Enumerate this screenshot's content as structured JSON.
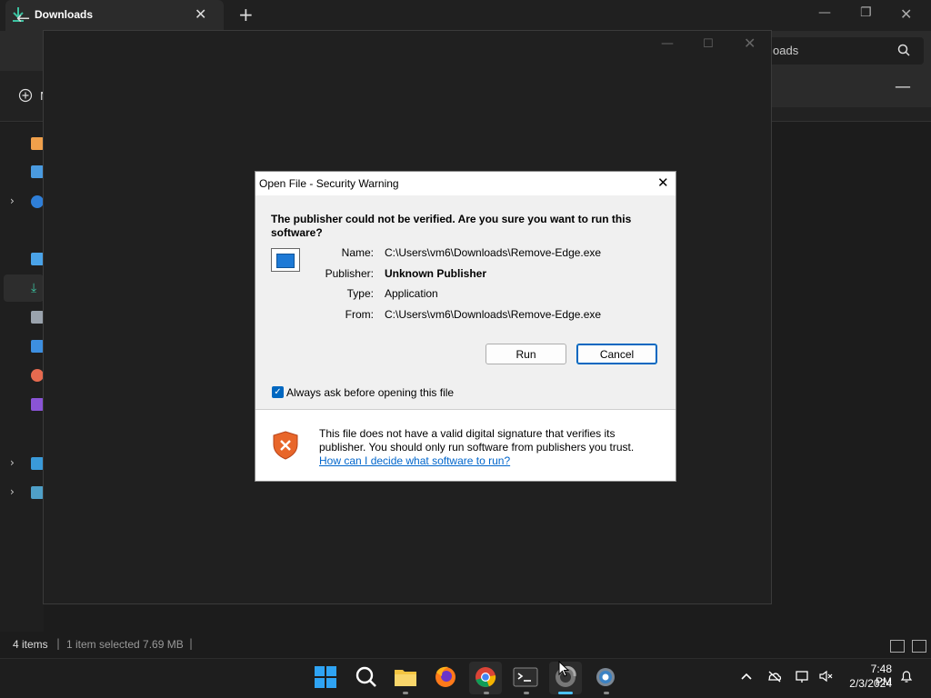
{
  "explorer": {
    "tab_title": "Downloads",
    "search_text": "oads",
    "new_label": "N",
    "status": {
      "items_count": "4 items",
      "separator": "|",
      "selected_info": "1 item selected  7.69 MB",
      "separator2": "|"
    }
  },
  "dialog": {
    "title": "Open File - Security Warning",
    "question": "The publisher could not be verified.  Are you sure you want to run this software?",
    "fields": {
      "name_label": "Name:",
      "name_value": "C:\\Users\\vm6\\Downloads\\Remove-Edge.exe",
      "publisher_label": "Publisher:",
      "publisher_value": "Unknown Publisher",
      "type_label": "Type:",
      "type_value": "Application",
      "from_label": "From:",
      "from_value": "C:\\Users\\vm6\\Downloads\\Remove-Edge.exe"
    },
    "run_label": "Run",
    "cancel_label": "Cancel",
    "checkbox_label": "Always ask before opening this file",
    "checkbox_checked": true,
    "warning_text": "This file does not have a valid digital signature that verifies its publisher.  You should only run software from publishers you trust.",
    "help_link": "How can I decide what software to run?"
  },
  "taskbar": {
    "time": "7:48 PM",
    "date": "2/3/2024",
    "apps": [
      "start-icon",
      "search-icon",
      "file-explorer-icon",
      "firefox-icon",
      "chrome-icon",
      "terminal-icon",
      "edge-remover-icon",
      "settings-icon"
    ]
  },
  "colors": {
    "accent": "#0067c0",
    "link": "#0066cc",
    "taskbar_active": "#4cc2ff",
    "shield": "#e8662a"
  }
}
